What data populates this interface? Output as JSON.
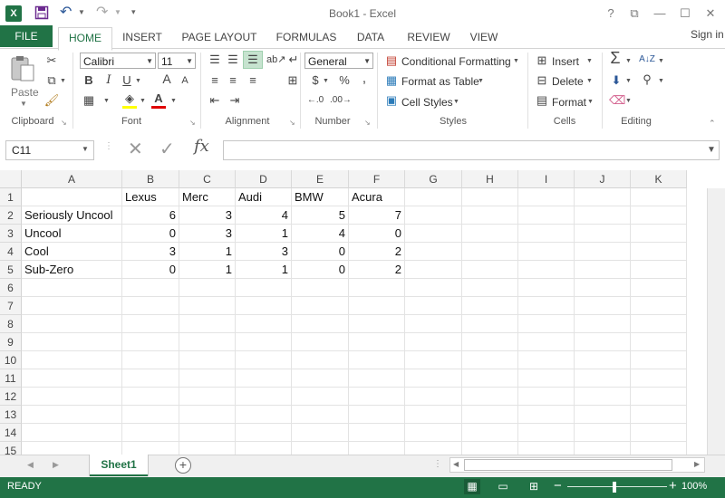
{
  "window": {
    "title": "Book1 - Excel",
    "app_logo": "X",
    "help": "?",
    "ribbon_display": "⧉",
    "minimize": "—",
    "maximize": "☐",
    "close": "✕"
  },
  "ribbon_tabs": [
    "FILE",
    "HOME",
    "INSERT",
    "PAGE LAYOUT",
    "FORMULAS",
    "DATA",
    "REVIEW",
    "VIEW"
  ],
  "active_tab": "HOME",
  "sign_in": "Sign in",
  "clipboard": {
    "paste": "Paste",
    "label": "Clipboard"
  },
  "font": {
    "name": "Calibri",
    "size": "11",
    "label": "Font"
  },
  "alignment": {
    "label": "Alignment"
  },
  "number": {
    "format": "General",
    "label": "Number",
    "dollar": "$",
    "percent": "%",
    "comma": ","
  },
  "styles": {
    "conditional": "Conditional Formatting",
    "format_table": "Format as Table",
    "cell_styles": "Cell Styles",
    "label": "Styles"
  },
  "cells": {
    "insert": "Insert",
    "delete": "Delete",
    "format": "Format",
    "label": "Cells"
  },
  "editing": {
    "label": "Editing"
  },
  "formula_bar": {
    "name_box": "C11",
    "fx": "fx",
    "value": ""
  },
  "grid": {
    "columns": [
      "A",
      "B",
      "C",
      "D",
      "E",
      "F",
      "G",
      "H",
      "I",
      "J",
      "K"
    ],
    "rows": [
      "1",
      "2",
      "3",
      "4",
      "5",
      "6",
      "7",
      "8",
      "9",
      "10",
      "11",
      "12",
      "13",
      "14",
      "15"
    ],
    "cells": [
      [
        "",
        "Lexus",
        "Merc",
        "Audi",
        "BMW",
        "Acura"
      ],
      [
        "Seriously Uncool",
        "6",
        "3",
        "4",
        "5",
        "7"
      ],
      [
        "Uncool",
        "0",
        "3",
        "1",
        "4",
        "0"
      ],
      [
        "Cool",
        "3",
        "1",
        "3",
        "0",
        "2"
      ],
      [
        "Sub-Zero",
        "0",
        "1",
        "1",
        "0",
        "2"
      ]
    ]
  },
  "sheet_tabs": [
    "Sheet1"
  ],
  "add_sheet": "+",
  "status": {
    "text": "READY",
    "zoom": "100%",
    "zoom_minus": "−",
    "zoom_plus": "+"
  },
  "colors": {
    "accent": "#217346"
  }
}
